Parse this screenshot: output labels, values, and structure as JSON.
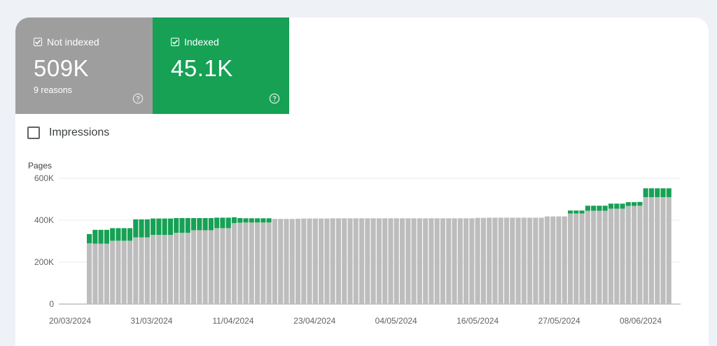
{
  "tiles": {
    "not_indexed": {
      "label": "Not indexed",
      "value": "509K",
      "sub": "9 reasons",
      "checked": true,
      "color": "#9e9e9e",
      "icon": "help-circle-icon"
    },
    "indexed": {
      "label": "Indexed",
      "value": "45.1K",
      "checked": true,
      "color": "#16a155",
      "icon": "help-circle-icon"
    }
  },
  "impressions": {
    "label": "Impressions",
    "checked": false
  },
  "chart_data": {
    "type": "bar",
    "stacked": true,
    "ylabel": "Pages",
    "ylim": [
      0,
      600000
    ],
    "yticks": [
      "0",
      "200K",
      "400K",
      "600K"
    ],
    "x_tick_labels": [
      "20/03/2024",
      "31/03/2024",
      "11/04/2024",
      "23/04/2024",
      "04/05/2024",
      "16/05/2024",
      "27/05/2024",
      "08/06/2024"
    ],
    "grid": true,
    "series": [
      {
        "name": "Not indexed",
        "color": "#bdbdbd",
        "values": [
          290000,
          288000,
          288000,
          288000,
          302000,
          302000,
          302000,
          302000,
          318000,
          318000,
          318000,
          330000,
          330000,
          330000,
          330000,
          340000,
          340000,
          340000,
          352000,
          352000,
          352000,
          352000,
          362000,
          362000,
          362000,
          386000,
          388000,
          389000,
          389000,
          389000,
          389000,
          389000,
          406000,
          406000,
          406000,
          406000,
          407000,
          408000,
          408000,
          408000,
          408000,
          408000,
          409000,
          409000,
          409000,
          409000,
          409000,
          409000,
          409000,
          409000,
          409000,
          409000,
          409000,
          409000,
          409000,
          409000,
          409000,
          409000,
          409000,
          409000,
          409000,
          409000,
          409000,
          409000,
          409000,
          409000,
          409000,
          411000,
          411000,
          412000,
          412000,
          412000,
          412000,
          412000,
          412000,
          412000,
          412000,
          412000,
          412000,
          418000,
          418000,
          418000,
          418000,
          432000,
          432000,
          432000,
          445000,
          445000,
          445000,
          445000,
          455000,
          455000,
          455000,
          468000,
          468000,
          469000,
          510000,
          510000,
          510000,
          510000,
          510000
        ]
      },
      {
        "name": "Indexed",
        "color": "#16a155",
        "values": [
          44000,
          66000,
          66000,
          66000,
          60000,
          60000,
          60000,
          60000,
          86000,
          86000,
          86000,
          78000,
          78000,
          78000,
          78000,
          70000,
          70000,
          70000,
          58000,
          58000,
          58000,
          58000,
          50000,
          50000,
          50000,
          28000,
          22000,
          20000,
          20000,
          20000,
          20000,
          20000,
          0,
          0,
          0,
          0,
          0,
          0,
          0,
          0,
          0,
          0,
          0,
          0,
          0,
          0,
          0,
          0,
          0,
          0,
          0,
          0,
          0,
          0,
          0,
          0,
          0,
          0,
          0,
          0,
          0,
          0,
          0,
          0,
          0,
          0,
          0,
          0,
          0,
          0,
          0,
          0,
          0,
          0,
          0,
          0,
          0,
          0,
          0,
          0,
          0,
          0,
          0,
          14000,
          14000,
          14000,
          24000,
          24000,
          24000,
          24000,
          24000,
          24000,
          24000,
          18000,
          18000,
          18000,
          42000,
          42000,
          42000,
          42000,
          42000
        ]
      }
    ]
  }
}
